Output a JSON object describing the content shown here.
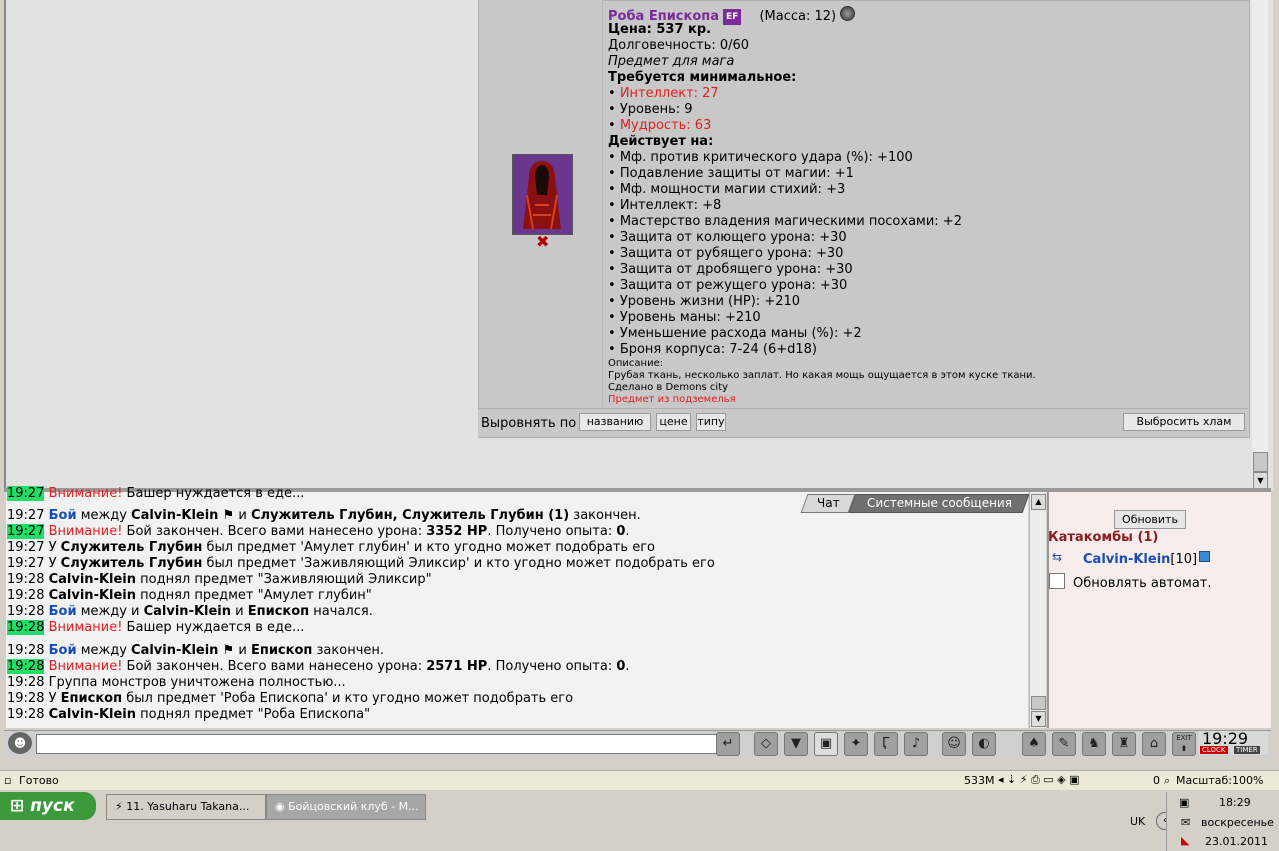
{
  "item": {
    "name": "Роба Епископа",
    "badge": "EF",
    "mass": "(Масса: 12)",
    "price": "Цена: 537 кр.",
    "durability": "Долговечность: 0/60",
    "class_note": "Предмет для мага",
    "requirements_title": "Требуется минимальное:",
    "requirements": [
      {
        "text": "Интеллект: 27",
        "unmet": true
      },
      {
        "text": "Уровень: 9",
        "unmet": false
      },
      {
        "text": "Мудрость: 63",
        "unmet": true
      }
    ],
    "effects_title": "Действует на:",
    "effects": [
      "Мф. против критического удара (%): +100",
      "Подавление защиты от магии: +1",
      "Мф. мощности магии стихий: +3",
      "Интеллект: +8",
      "Мастерство владения магическими посохами: +2",
      "Защита от колющего урона: +30",
      "Защита от рубящего урона: +30",
      "Защита от дробящего урона: +30",
      "Защита от режущего урона: +30",
      "Уровень жизни (HP): +210",
      "Уровень маны: +210",
      "Уменьшение расхода маны (%): +2",
      "Броня корпуса: 7-24 (6+d18)"
    ],
    "description_label": "Описание:",
    "description": "Грубая ткань, несколько заплат. Но какая мощь ощущается в этом куске ткани.",
    "made_in": "Сделано в Demons city",
    "origin": "Предмет из подземелья",
    "remove_symbol": "✖"
  },
  "sort": {
    "label": "Выровнять по",
    "by_name": "названию",
    "by_price": "цене",
    "by_type": "типу",
    "discard": "Выбросить хлам"
  },
  "chat": {
    "tabs": {
      "chat": "Чат",
      "system": "Системные сообщения"
    },
    "lines": [
      {
        "time": "19:27",
        "hl": true,
        "parts": [
          {
            "t": "Внимание!",
            "c": "red"
          },
          {
            "t": " Башер нуждается в еде...",
            "c": ""
          }
        ]
      },
      {
        "time": "19:27",
        "hl": false,
        "parts": [
          {
            "t": "Бой",
            "c": "blue"
          },
          {
            "t": " между ",
            "c": ""
          },
          {
            "t": "Calvin-Klein",
            "c": "b"
          },
          {
            "t": " ⚑ и ",
            "c": ""
          },
          {
            "t": "Служитель Глубин, Служитель Глубин (1)",
            "c": "b"
          },
          {
            "t": " закончен.",
            "c": ""
          }
        ]
      },
      {
        "time": "19:27",
        "hl": true,
        "parts": [
          {
            "t": "Внимание!",
            "c": "red"
          },
          {
            "t": " Бой закончен. Всего вами нанесено урона: ",
            "c": ""
          },
          {
            "t": "3352 HP",
            "c": "b"
          },
          {
            "t": ". Получено опыта: ",
            "c": ""
          },
          {
            "t": "0",
            "c": "b"
          },
          {
            "t": ".",
            "c": ""
          }
        ]
      },
      {
        "time": "19:27",
        "hl": false,
        "parts": [
          {
            "t": "У ",
            "c": ""
          },
          {
            "t": "Служитель Глубин",
            "c": "b"
          },
          {
            "t": " был предмет 'Амулет глубин' и кто угодно может подобрать его",
            "c": ""
          }
        ]
      },
      {
        "time": "19:27",
        "hl": false,
        "parts": [
          {
            "t": "У ",
            "c": ""
          },
          {
            "t": "Служитель Глубин",
            "c": "b"
          },
          {
            "t": " был предмет 'Заживляющий Эликсир' и кто угодно может подобрать его",
            "c": ""
          }
        ]
      },
      {
        "time": "19:28",
        "hl": false,
        "parts": [
          {
            "t": "Calvin-Klein",
            "c": "b"
          },
          {
            "t": " поднял предмет \"Заживляющий Эликсир\"",
            "c": ""
          }
        ]
      },
      {
        "time": "19:28",
        "hl": false,
        "parts": [
          {
            "t": "Calvin-Klein",
            "c": "b"
          },
          {
            "t": " поднял предмет \"Амулет глубин\"",
            "c": ""
          }
        ]
      },
      {
        "time": "19:28",
        "hl": false,
        "parts": [
          {
            "t": "Бой",
            "c": "blue"
          },
          {
            "t": " между и ",
            "c": ""
          },
          {
            "t": "Calvin-Klein",
            "c": "b"
          },
          {
            "t": " и ",
            "c": ""
          },
          {
            "t": "Епископ",
            "c": "b"
          },
          {
            "t": " начался.",
            "c": ""
          }
        ]
      },
      {
        "time": "19:28",
        "hl": true,
        "parts": [
          {
            "t": "Внимание!",
            "c": "red"
          },
          {
            "t": " Башер нуждается в еде...",
            "c": ""
          }
        ]
      },
      {
        "time": "19:28",
        "hl": false,
        "parts": [
          {
            "t": "Бой",
            "c": "blue"
          },
          {
            "t": " между ",
            "c": ""
          },
          {
            "t": "Calvin-Klein",
            "c": "b"
          },
          {
            "t": " ⚑ и ",
            "c": ""
          },
          {
            "t": "Епископ",
            "c": "b"
          },
          {
            "t": " закончен.",
            "c": ""
          }
        ]
      },
      {
        "time": "19:28",
        "hl": true,
        "parts": [
          {
            "t": "Внимание!",
            "c": "red"
          },
          {
            "t": " Бой закончен. Всего вами нанесено урона: ",
            "c": ""
          },
          {
            "t": "2571 HP",
            "c": "b"
          },
          {
            "t": ". Получено опыта: ",
            "c": ""
          },
          {
            "t": "0",
            "c": "b"
          },
          {
            "t": ".",
            "c": ""
          }
        ]
      },
      {
        "time": "19:28",
        "hl": false,
        "parts": [
          {
            "t": "Группа монстров уничтожена полностью...",
            "c": ""
          }
        ]
      },
      {
        "time": "19:28",
        "hl": false,
        "parts": [
          {
            "t": "У ",
            "c": ""
          },
          {
            "t": "Епископ",
            "c": "b"
          },
          {
            "t": " был предмет 'Роба Епископа' и кто угодно может подобрать его",
            "c": ""
          }
        ]
      },
      {
        "time": "19:28",
        "hl": false,
        "parts": [
          {
            "t": "Calvin-Klein",
            "c": "b"
          },
          {
            "t": " поднял предмет \"Роба Епископа\"",
            "c": ""
          }
        ]
      }
    ]
  },
  "location_panel": {
    "refresh": "Обновить",
    "location": "Катакомбы (1)",
    "player_name": "Calvin-Klein",
    "player_level": "[10]",
    "auto_refresh": "Обновлять автомат."
  },
  "toolbar": {
    "clock": "19:29",
    "clock_label": "CLOCK",
    "timer_label": "TIMER",
    "exit_label": "EXIT"
  },
  "statusbar": {
    "status": "Готово",
    "memory": "533M",
    "counter": "0",
    "zoom": "Масштаб:100%"
  },
  "taskbar": {
    "start": "пуск",
    "tasks": [
      "11. Yasuharu Takana...",
      "Бойцовский клуб - М..."
    ],
    "lang": "UK",
    "time": "18:29",
    "day": "воскресенье",
    "date": "23.01.2011"
  },
  "colors": {
    "item_name": "#7a2a9a",
    "unmet_requirement": "#e02020",
    "chat_highlight": "#22dd66",
    "battle_link": "#1a4db3",
    "location_title": "#8b1a1a"
  }
}
